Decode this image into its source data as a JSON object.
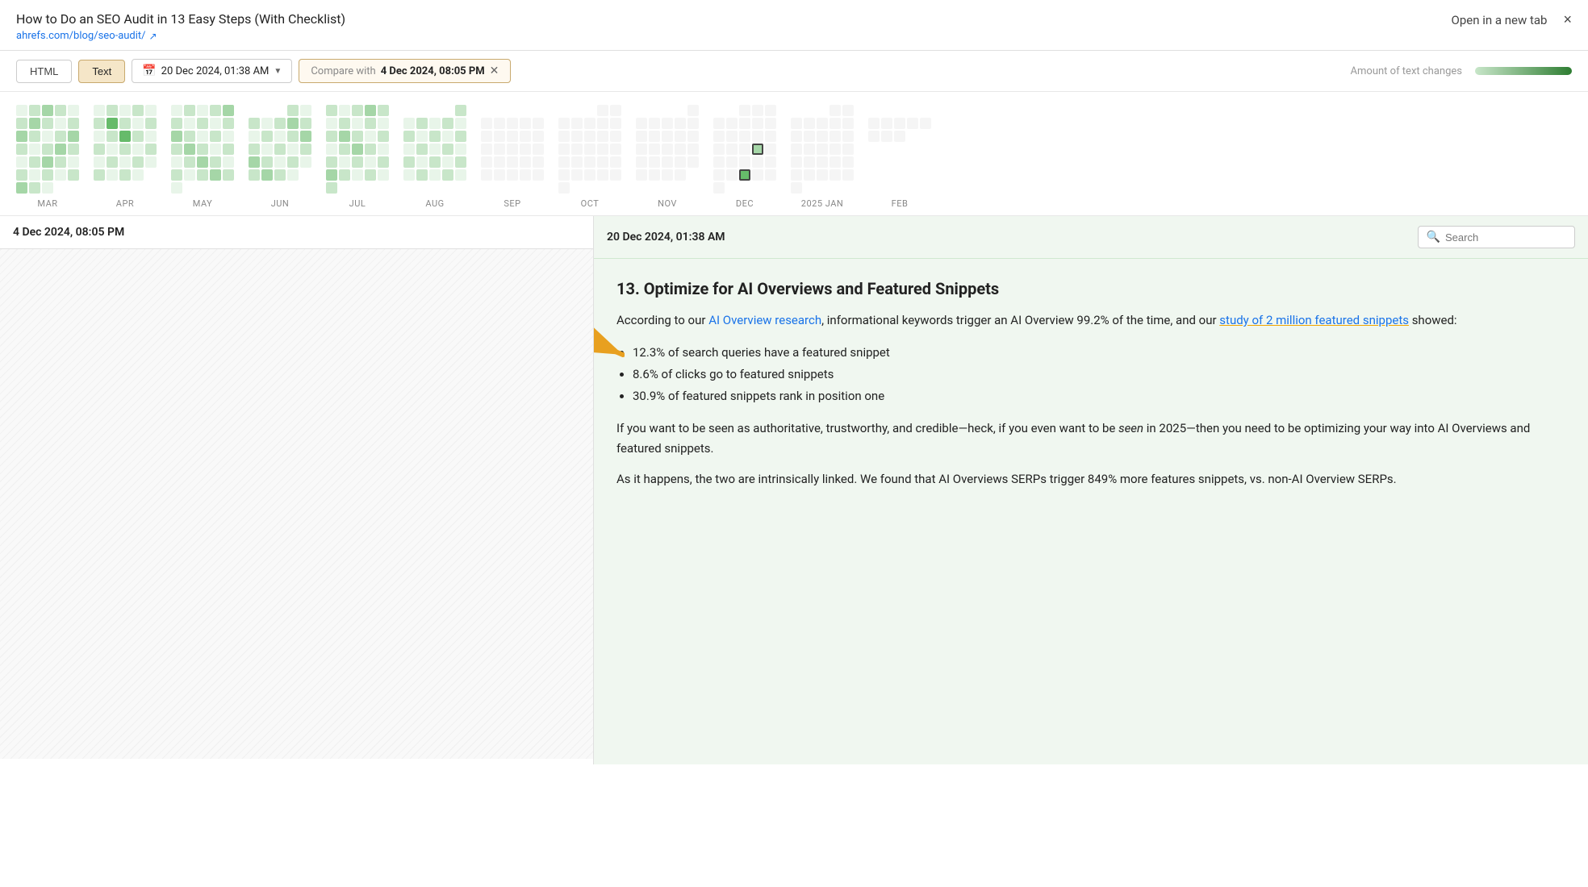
{
  "header": {
    "title": "How to Do an SEO Audit in 13 Easy Steps (With Checklist)",
    "url": "ahrefs.com/blog/seo-audit/",
    "open_new_tab": "Open in a new tab",
    "close": "×"
  },
  "toolbar": {
    "html_label": "HTML",
    "text_label": "Text",
    "date": "20 Dec 2024, 01:38 AM",
    "compare_prefix": "Compare with",
    "compare_date": "4 Dec 2024, 08:05 PM",
    "amount_label": "Amount of text changes"
  },
  "months": [
    "MAR",
    "APR",
    "MAY",
    "JUN",
    "JUL",
    "AUG",
    "SEP",
    "OCT",
    "NOV",
    "DEC",
    "2025 JAN",
    "FEB"
  ],
  "left_panel": {
    "date": "4 Dec 2024, 08:05 PM"
  },
  "right_panel": {
    "date": "20 Dec 2024, 01:38 AM",
    "search_placeholder": "Search",
    "heading": "13. Optimize for AI Overviews and Featured Snippets",
    "paragraph1_pre": "According to our ",
    "link1": "AI Overview research",
    "paragraph1_mid": ", informational keywords trigger an AI Overview 99.2% of the time, and our ",
    "link2": "study of 2 million featured snippets",
    "paragraph1_post": " showed:",
    "bullets": [
      "12.3% of search queries have a featured snippet",
      "8.6% of clicks go to featured snippets",
      "30.9% of featured snippets rank in position one"
    ],
    "paragraph2": "If you want to be seen as authoritative, trustworthy, and credible—heck, if you even want to be seen in 2025—then you need to be optimizing your way into AI Overviews and featured snippets.",
    "paragraph2_italic": "seen",
    "paragraph3": "As it happens, the two are intrinsically linked. We found that AI Overviews SERPs trigger 849% more features snippets, vs. non-AI Overview SERPs."
  }
}
